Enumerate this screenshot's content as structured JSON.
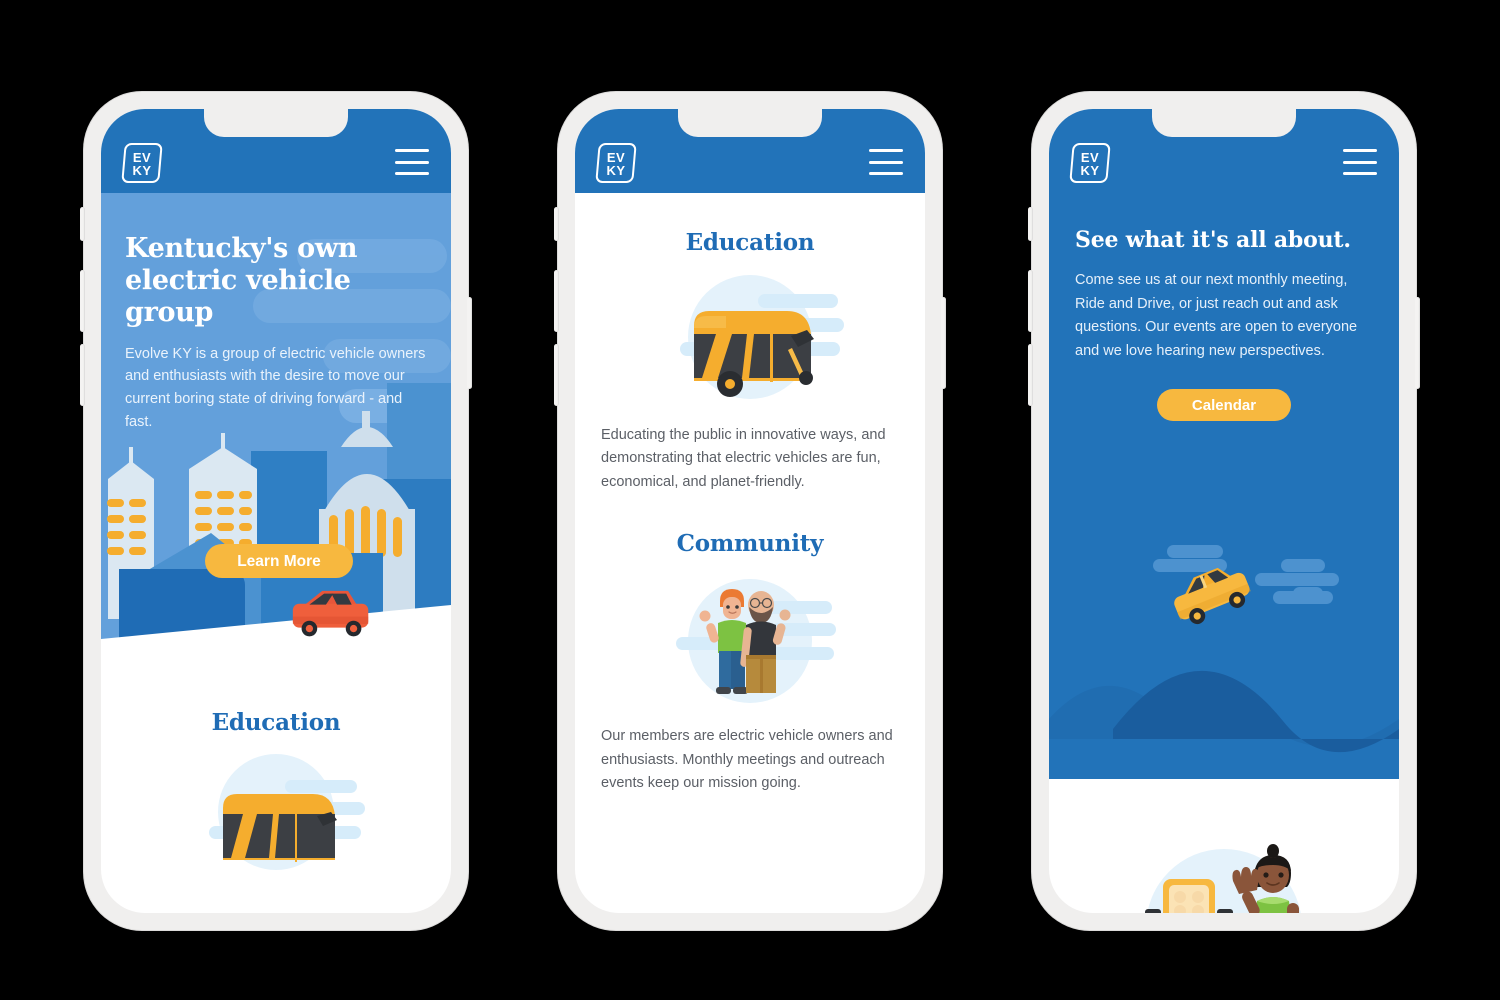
{
  "meta": {
    "background_color": "#000000",
    "frame_color": "#f0efee",
    "brand_blue": "#2273b9",
    "hero_light_blue": "#63a0db",
    "accent_yellow": "#f7b83f",
    "heading_blue": "#1f6cb5",
    "body_gray": "#5b5f66"
  },
  "brand": {
    "logo_line1": "EV",
    "logo_line2": "KY",
    "menu_label": "Menu"
  },
  "phones": [
    {
      "id": "phone-home",
      "hero": {
        "heading": "Kentucky's own electric vehicle group",
        "paragraph": "Evolve KY is a group of electric vehicle owners and enthusiasts with the desire to move our current boring state of driving forward - and fast.",
        "cta_label": "Learn More",
        "illustration": "city-skyline-with-red-car"
      },
      "sections": [
        {
          "title": "Education",
          "illustration": "yellow-electric-bus",
          "body": ""
        }
      ]
    },
    {
      "id": "phone-sections",
      "sections": [
        {
          "title": "Education",
          "illustration": "yellow-electric-bus",
          "body": "Educating the public in innovative ways, and demonstrating that electric vehicles are fun, economical, and planet-friendly."
        },
        {
          "title": "Community",
          "illustration": "two-members-thumbs-up",
          "body": "Our members are electric vehicle owners and enthusiasts. Monthly meetings and outreach events keep our mission going."
        }
      ]
    },
    {
      "id": "phone-events",
      "hero": {
        "heading": "See what it's all about.",
        "paragraph": "Come see us at our next monthly meeting, Ride and Drive, or just reach out and ask questions. Our events are open to everyone and we love hearing new perspectives.",
        "cta_label": "Calendar",
        "illustration": "yellow-car-on-hill-with-clouds"
      },
      "sections": [
        {
          "title": "",
          "illustration": "person-waving-at-ev-charging-station",
          "body": ""
        }
      ]
    }
  ]
}
